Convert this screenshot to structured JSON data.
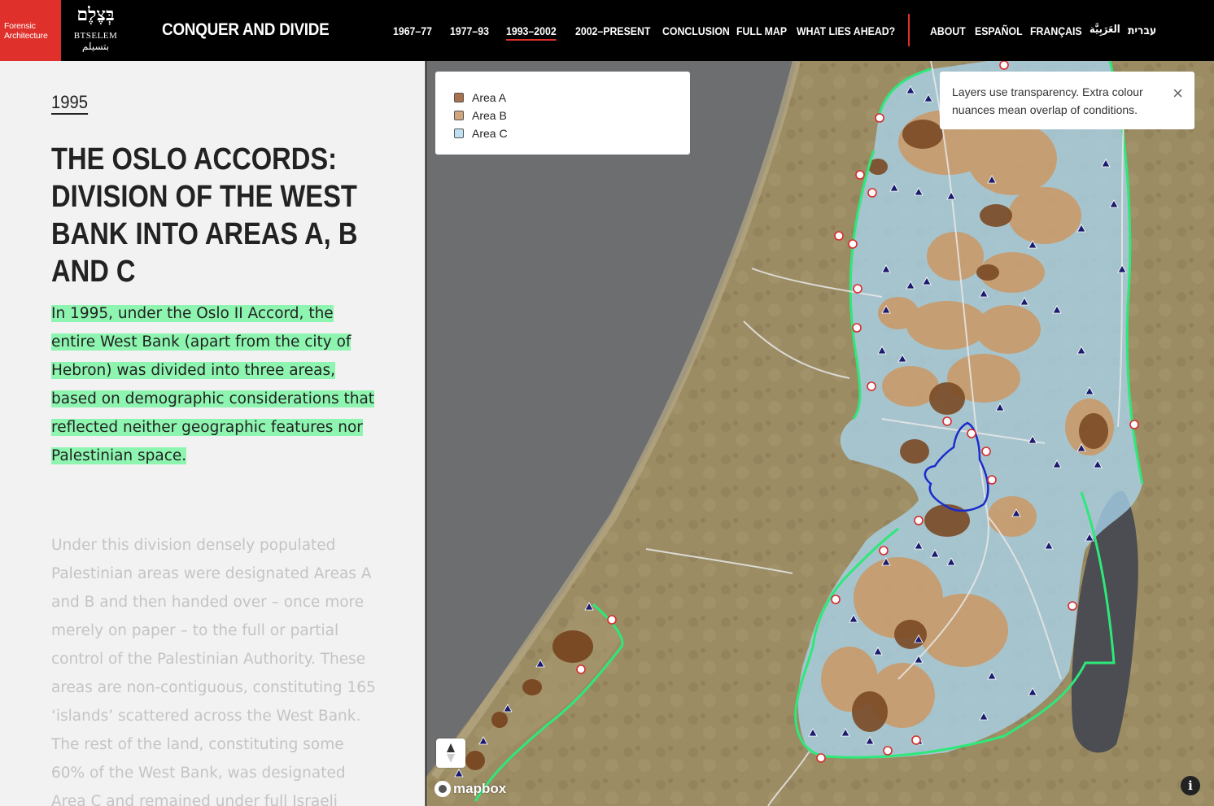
{
  "header": {
    "fa_logo_line1": "Forensic",
    "fa_logo_line2": "Architecture",
    "btselem_hebrew": "בְּצֶלֶם",
    "btselem_latin": "BTSELEM",
    "btselem_arabic": "بتسيلم",
    "site_title": "CONQUER AND DIVIDE",
    "nav": [
      {
        "label": "1967–77"
      },
      {
        "label": "1977–93"
      },
      {
        "label": "1993–2002",
        "active": true
      },
      {
        "label": "2002–PRESENT"
      },
      {
        "label": "CONCLUSION"
      },
      {
        "label": "FULL MAP"
      },
      {
        "label": "WHAT LIES AHEAD?"
      }
    ],
    "lang_nav": [
      {
        "label": "ABOUT"
      },
      {
        "label": "ESPAÑOL"
      },
      {
        "label": "FRANÇAIS"
      },
      {
        "label": "العَرَبِيَّة"
      },
      {
        "label": "עברית"
      }
    ]
  },
  "story": {
    "year": "1995",
    "headline": "THE OSLO ACCORDS: DIVISION OF THE WEST BANK INTO AREAS A, B AND C",
    "paragraph1": "In 1995, under the Oslo II Accord, the entire West Bank (apart from the city of Hebron) was divided into three areas, based on demographic considerations that reflected neither geographic features nor Palestinian space.",
    "paragraph2": "Under this division densely populated Palestinian areas were designated Areas A and B and then handed over – once more merely on paper – to the full or partial control of the Palestinian Authority. These areas are non-contiguous, constituting 165 ‘islands’ scattered across the West Bank. The rest of the land, constituting some 60% of the West Bank, was designated Area C and remained under full Israeli control."
  },
  "map": {
    "legend": [
      {
        "label": "Area A",
        "color": "#8a5a36"
      },
      {
        "label": "Area B",
        "color": "#c99a6a"
      },
      {
        "label": "Area C",
        "color": "#a9d4ec"
      }
    ],
    "tooltip": "Layers use transparency. Extra colour nuances mean overlap of conditions.",
    "close_icon": "×",
    "attribution": "mapbox",
    "info_icon": "i",
    "colors": {
      "sea": "#6c6d6f",
      "land": "#9a8a62",
      "border": "#2ee87a",
      "settlement": "#1a1a6e",
      "checkpoint": "#d82a2a",
      "jerusalem": "#1a2bcc"
    }
  }
}
